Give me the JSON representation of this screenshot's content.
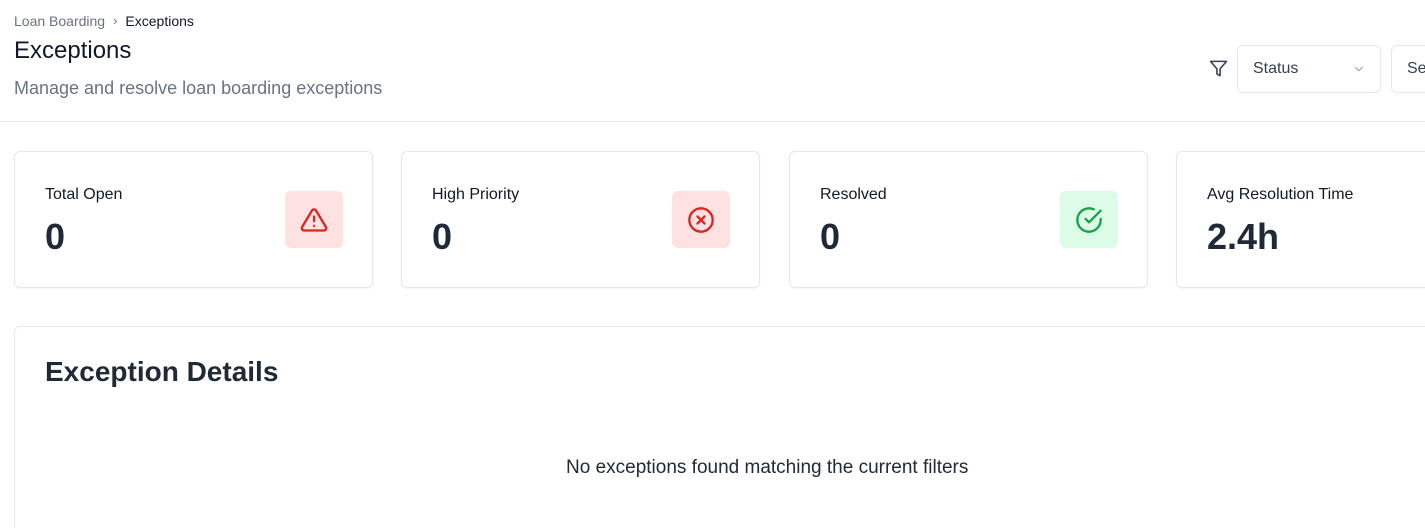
{
  "breadcrumb": {
    "items": [
      "Loan Boarding",
      "Exceptions"
    ],
    "separator": "›"
  },
  "header": {
    "title": "Exceptions",
    "subtitle": "Manage and resolve loan boarding exceptions"
  },
  "filters": {
    "icon": "filter-icon",
    "status": {
      "value": "Status"
    },
    "second": {
      "value": "Se"
    }
  },
  "stats": [
    {
      "label": "Total Open",
      "value": "0",
      "icon": "alert-triangle-icon",
      "accent": "#dc2626",
      "icon_bg": "#fee2e2"
    },
    {
      "label": "High Priority",
      "value": "0",
      "icon": "x-circle-icon",
      "accent": "#dc2626",
      "icon_bg": "#fee2e2"
    },
    {
      "label": "Resolved",
      "value": "0",
      "icon": "check-circle-icon",
      "accent": "#16a34a",
      "icon_bg": "#dcfce7"
    },
    {
      "label": "Avg Resolution Time",
      "value": "2.4h"
    }
  ],
  "details": {
    "title": "Exception Details",
    "empty_message": "No exceptions found matching the current filters"
  }
}
